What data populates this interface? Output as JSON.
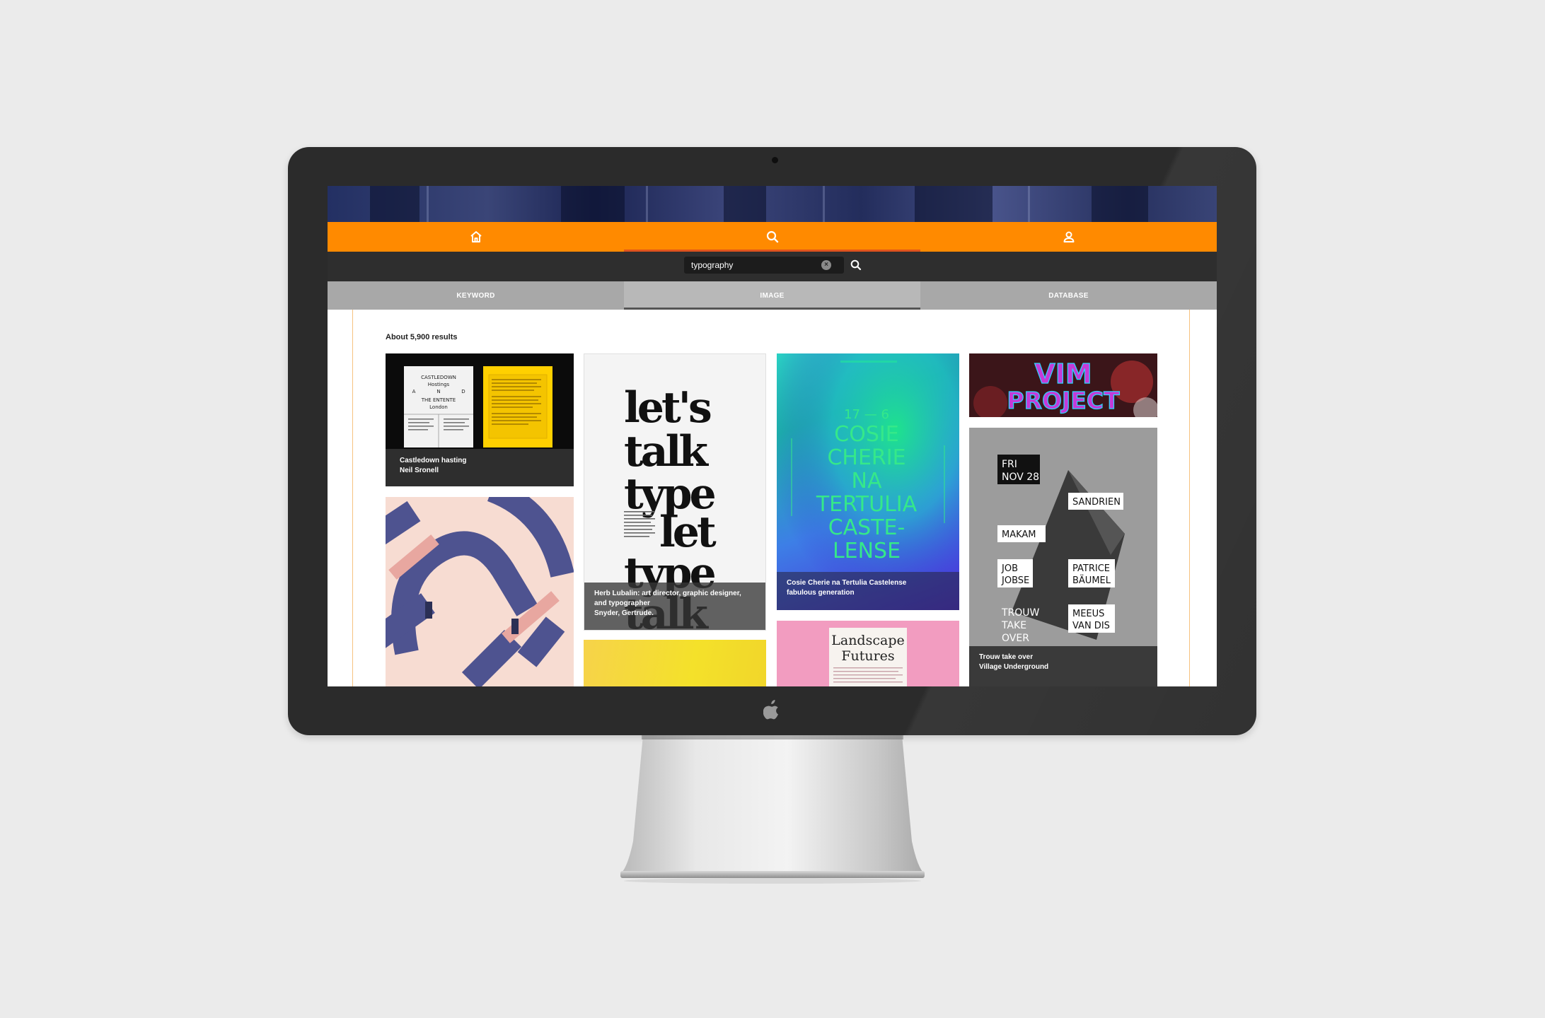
{
  "nav": {
    "items": [
      {
        "icon": "home-icon",
        "active": false
      },
      {
        "icon": "search-icon",
        "active": true
      },
      {
        "icon": "user-icon",
        "active": false
      }
    ],
    "accent_color": "#ff8a00",
    "active_color": "#e0531d"
  },
  "search": {
    "value": "typography",
    "clear_icon": "×"
  },
  "tabs": [
    {
      "label": "KEYWORD",
      "active": false
    },
    {
      "label": "IMAGE",
      "active": true
    },
    {
      "label": "DATABASE",
      "active": false
    }
  ],
  "results": {
    "count_text": "About 5,900 results"
  },
  "cards": {
    "castledown": {
      "caption": [
        "Castledown hasting",
        "Neil Sronell"
      ],
      "poster_title": [
        "CASTLEDOWN",
        "Hostings",
        "A",
        "N",
        "D",
        "THE ENTENTE",
        "London"
      ]
    },
    "lubalin": {
      "caption": [
        "Herb Lubalin: art director, graphic designer,",
        "and typographer",
        "Snyder, Gertrude."
      ],
      "poster_lines": [
        "let's",
        "talk",
        "type",
        "let",
        "type",
        "talk"
      ]
    },
    "cosie": {
      "caption": [
        "Cosie Cherie na Tertulia Castelense",
        "fabulous generation"
      ],
      "poster_date": "17 — 6",
      "poster_lines": [
        "COSIE",
        "CHERIE",
        "NA",
        "TERTULIA",
        "CASTE-",
        "LENSE"
      ]
    },
    "vim": {
      "poster_lines": [
        "VIM",
        "PROJECT"
      ]
    },
    "trouw": {
      "caption": [
        "Trouw take over",
        "Village Underground"
      ],
      "poster_date": [
        "FRI",
        "NOV 28"
      ],
      "poster_names": [
        "SANDRIEN",
        "MAKAM",
        "JOB",
        "JOBSE",
        "PATRICE",
        "BÄUMEL",
        "TROUW",
        "TAKE",
        "OVER",
        "MEEUS",
        "VAN DIS"
      ]
    },
    "landscape": {
      "poster_lines": [
        "Landscape",
        "Futures"
      ]
    }
  }
}
